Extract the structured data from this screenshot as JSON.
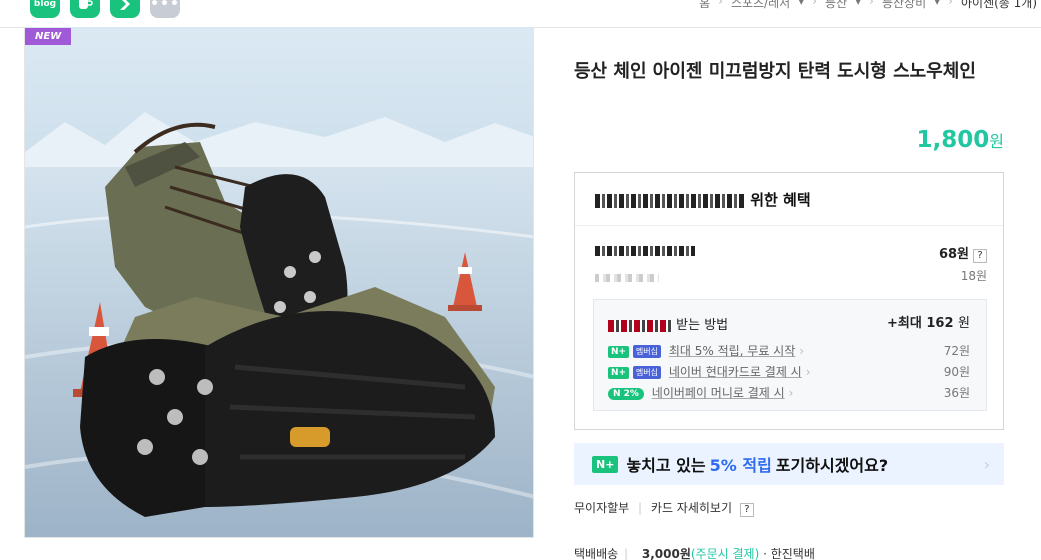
{
  "share": {
    "blog_label": "blog",
    "icons": [
      "blog-icon",
      "cafe-icon",
      "band-icon",
      "more-icon"
    ],
    "more_label": "•••"
  },
  "breadcrumb": [
    "홈",
    "스포츠/레저",
    "등산",
    "등산장비",
    "아이젠(총 1개)"
  ],
  "product": {
    "badge": "NEW",
    "title": "등산 체인 아이젠 미끄럼방지 탄력 도시형 스노우체인",
    "price_value": "1,800",
    "price_unit": "원"
  },
  "benefit": {
    "header_suffix": "위한 혜택",
    "point_amount": "68원",
    "point_help": "?",
    "point_sub": "18원",
    "card_suffix": "받는 방법",
    "card_max": "+최대 162",
    "card_max_unit": "원",
    "rows": [
      {
        "pill1": "N+",
        "pill2": "멤버십",
        "text": "최대 5% 적립, 무료 시작",
        "value": "72원"
      },
      {
        "pill1": "N+",
        "pill2": "멤버십",
        "text": "네이버 현대카드로 결제 시",
        "value": "90원"
      },
      {
        "pill1": "N 2%",
        "pill2": "",
        "text": "네이버페이 머니로 결제 시",
        "value": "36원"
      }
    ]
  },
  "promo": {
    "pill": "N+",
    "text_before": "놓치고 있는",
    "highlight": "5% 적립",
    "text_after": "포기하시겠어요?"
  },
  "interest": {
    "label": "무이자할부",
    "link": "카드 자세히보기",
    "help": "?"
  },
  "shipping": {
    "label": "택배배송",
    "fee": "3,000원",
    "note": "(주문시 결제)",
    "carrier": "· 한진택배"
  },
  "colors": {
    "accent": "#20c7a0",
    "naver_green": "#19c37d",
    "badge_purple": "#a05ad8",
    "promo_bg": "#eaf3ff",
    "promo_blue": "#2e6bf0"
  }
}
